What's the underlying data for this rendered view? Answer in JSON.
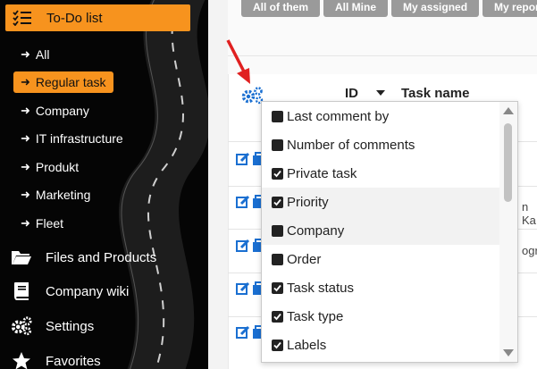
{
  "sidebar": {
    "header_label": "To-Do list",
    "sub_items": [
      {
        "label": "All",
        "active": false
      },
      {
        "label": "Regular task",
        "active": true
      },
      {
        "label": "Company",
        "active": false
      },
      {
        "label": "IT infrastructure",
        "active": false
      },
      {
        "label": "Produkt",
        "active": false
      },
      {
        "label": "Marketing",
        "active": false
      },
      {
        "label": "Fleet",
        "active": false
      }
    ],
    "main_items": [
      {
        "label": "Files and Products",
        "icon": "folder-icon"
      },
      {
        "label": "Company wiki",
        "icon": "book-icon"
      },
      {
        "label": "Settings",
        "icon": "gears-icon"
      },
      {
        "label": "Favorites",
        "icon": "star-icon"
      }
    ]
  },
  "tabs": [
    "All of them",
    "All Mine",
    "My assigned",
    "My reports"
  ],
  "table": {
    "columns": {
      "id": "ID",
      "task_name": "Task name"
    },
    "row_tail_texts": [
      "",
      "n Ka",
      "ogra",
      "",
      ""
    ]
  },
  "column_dropdown": {
    "options": [
      {
        "label": "Last comment by",
        "checked": false
      },
      {
        "label": "Number of comments",
        "checked": false
      },
      {
        "label": "Private task",
        "checked": true
      },
      {
        "label": "Priority",
        "checked": true
      },
      {
        "label": "Company",
        "checked": false
      },
      {
        "label": "Order",
        "checked": false
      },
      {
        "label": "Task status",
        "checked": true
      },
      {
        "label": "Task type",
        "checked": true
      },
      {
        "label": "Labels",
        "checked": true
      }
    ]
  },
  "colors": {
    "accent": "#f7931e",
    "link_icon": "#1a6fd1",
    "arrow": "#e02020",
    "sidebar_bg": "#050505",
    "tab_bg": "#9a9a9a"
  }
}
